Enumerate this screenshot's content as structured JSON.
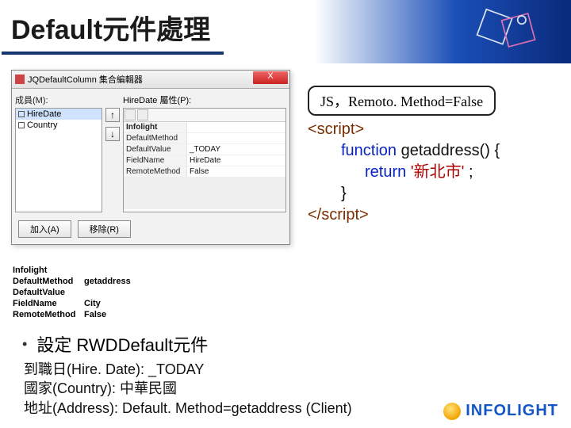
{
  "header": {
    "title": "Default元件處理"
  },
  "dialog": {
    "title": "JQDefaultColumn 集合編輯器",
    "close_x": "X",
    "members_label": "成員(M):",
    "members": [
      "HireDate",
      "Country"
    ],
    "arrow_up": "↑",
    "arrow_down": "↓",
    "props_label": "HireDate 屬性(P):",
    "prop_section": "Infolight",
    "props": [
      {
        "k": "DefaultMethod",
        "v": ""
      },
      {
        "k": "DefaultValue",
        "v": "_TODAY"
      },
      {
        "k": "FieldName",
        "v": "HireDate"
      },
      {
        "k": "RemoteMethod",
        "v": "False"
      }
    ],
    "btn_add": "加入(A)",
    "btn_remove": "移除(R)"
  },
  "badge": {
    "text": "JS，Remoto. Method=False"
  },
  "code": {
    "open": "<script>",
    "fn_kw": "function",
    "fn_name": "getaddress() {",
    "ret_kw": "return",
    "ret_val": "'新北市'",
    "semicolon": ";",
    "close_brace": "}",
    "close": "</script>"
  },
  "propshot2": {
    "section": "Infolight",
    "rows": [
      {
        "k": "DefaultMethod",
        "v": "getaddress"
      },
      {
        "k": "DefaultValue",
        "v": ""
      },
      {
        "k": "FieldName",
        "v": "City"
      },
      {
        "k": "RemoteMethod",
        "v": "False"
      }
    ]
  },
  "bullet": {
    "title": "設定 RWDDefault元件",
    "line1": "到職日(Hire. Date): _TODAY",
    "line2": "國家(Country): 中華民國",
    "line3": "地址(Address):  Default. Method=getaddress (Client)"
  },
  "logo": {
    "text": "INFOLIGHT"
  }
}
